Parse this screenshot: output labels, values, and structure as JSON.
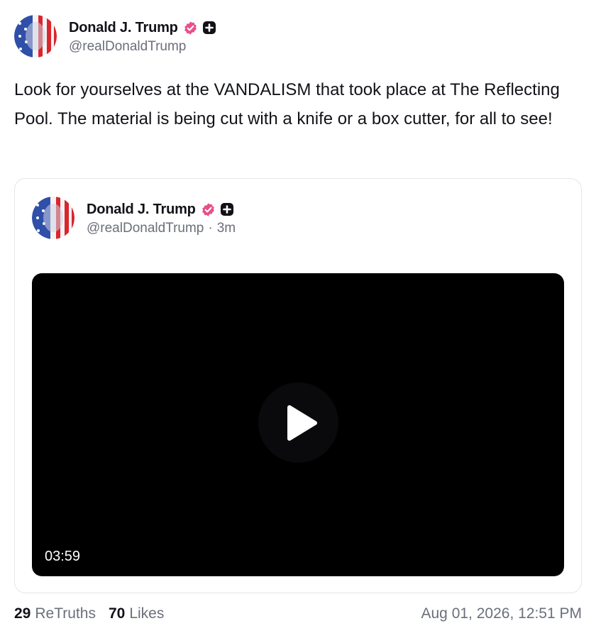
{
  "post": {
    "author": {
      "display_name": "Donald J. Trump",
      "handle": "@realDonaldTrump",
      "avatar_icon": "flag-portrait-avatar",
      "verified_icon": "verified-badge-icon",
      "plus_icon": "plus-square-icon"
    },
    "text": "Look for yourselves at the VANDALISM that took place at The Reflecting Pool. The material is being cut with a knife or a box cutter, for all to see!"
  },
  "quoted_post": {
    "author": {
      "display_name": "Donald J. Trump",
      "handle": "@realDonaldTrump",
      "separator": "·",
      "age": "3m"
    },
    "video": {
      "duration": "03:59",
      "play_icon": "play-icon"
    }
  },
  "footer": {
    "retruths_count": "29",
    "retruths_label": "ReTruths",
    "likes_count": "70",
    "likes_label": "Likes",
    "timestamp": "Aug 01, 2026, 12:51 PM"
  },
  "colors": {
    "verified_badge": "#e8508a",
    "text_primary": "#111217",
    "text_secondary": "#6b6f7a",
    "card_border": "#e4e5ea"
  }
}
